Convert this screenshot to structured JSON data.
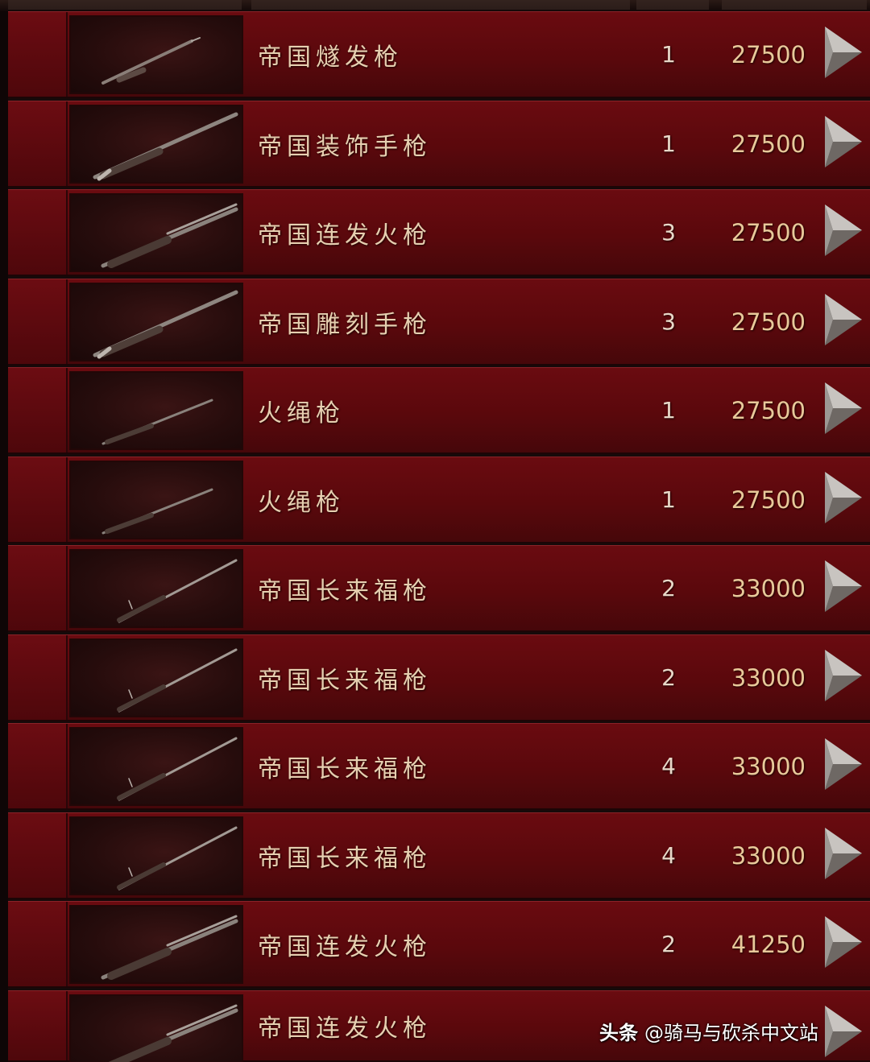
{
  "items": [
    {
      "name": "帝国燧发枪",
      "qty": "1",
      "price": "27500",
      "icon": "flintlock-gun-icon"
    },
    {
      "name": "帝国装饰手枪",
      "qty": "1",
      "price": "27500",
      "icon": "pistol-icon"
    },
    {
      "name": "帝国连发火枪",
      "qty": "3",
      "price": "27500",
      "icon": "repeating-musket-icon"
    },
    {
      "name": "帝国雕刻手枪",
      "qty": "3",
      "price": "27500",
      "icon": "pistol-icon"
    },
    {
      "name": "火绳枪",
      "qty": "1",
      "price": "27500",
      "icon": "matchlock-gun-icon"
    },
    {
      "name": "火绳枪",
      "qty": "1",
      "price": "27500",
      "icon": "matchlock-gun-icon"
    },
    {
      "name": "帝国长来福枪",
      "qty": "2",
      "price": "33000",
      "icon": "long-rifle-icon"
    },
    {
      "name": "帝国长来福枪",
      "qty": "2",
      "price": "33000",
      "icon": "long-rifle-icon"
    },
    {
      "name": "帝国长来福枪",
      "qty": "4",
      "price": "33000",
      "icon": "long-rifle-icon"
    },
    {
      "name": "帝国长来福枪",
      "qty": "4",
      "price": "33000",
      "icon": "long-rifle-icon"
    },
    {
      "name": "帝国连发火枪",
      "qty": "2",
      "price": "41250",
      "icon": "repeating-musket-icon"
    },
    {
      "name": "帝国连发火枪",
      "qty": "",
      "price": "",
      "icon": "repeating-musket-icon"
    }
  ],
  "watermark": {
    "brand": "头条",
    "text": "@骑马与砍杀中文站"
  },
  "colors": {
    "row_bg": "#5a080c",
    "name_text": "#e6cfb0",
    "price_text": "#e8c99a"
  }
}
